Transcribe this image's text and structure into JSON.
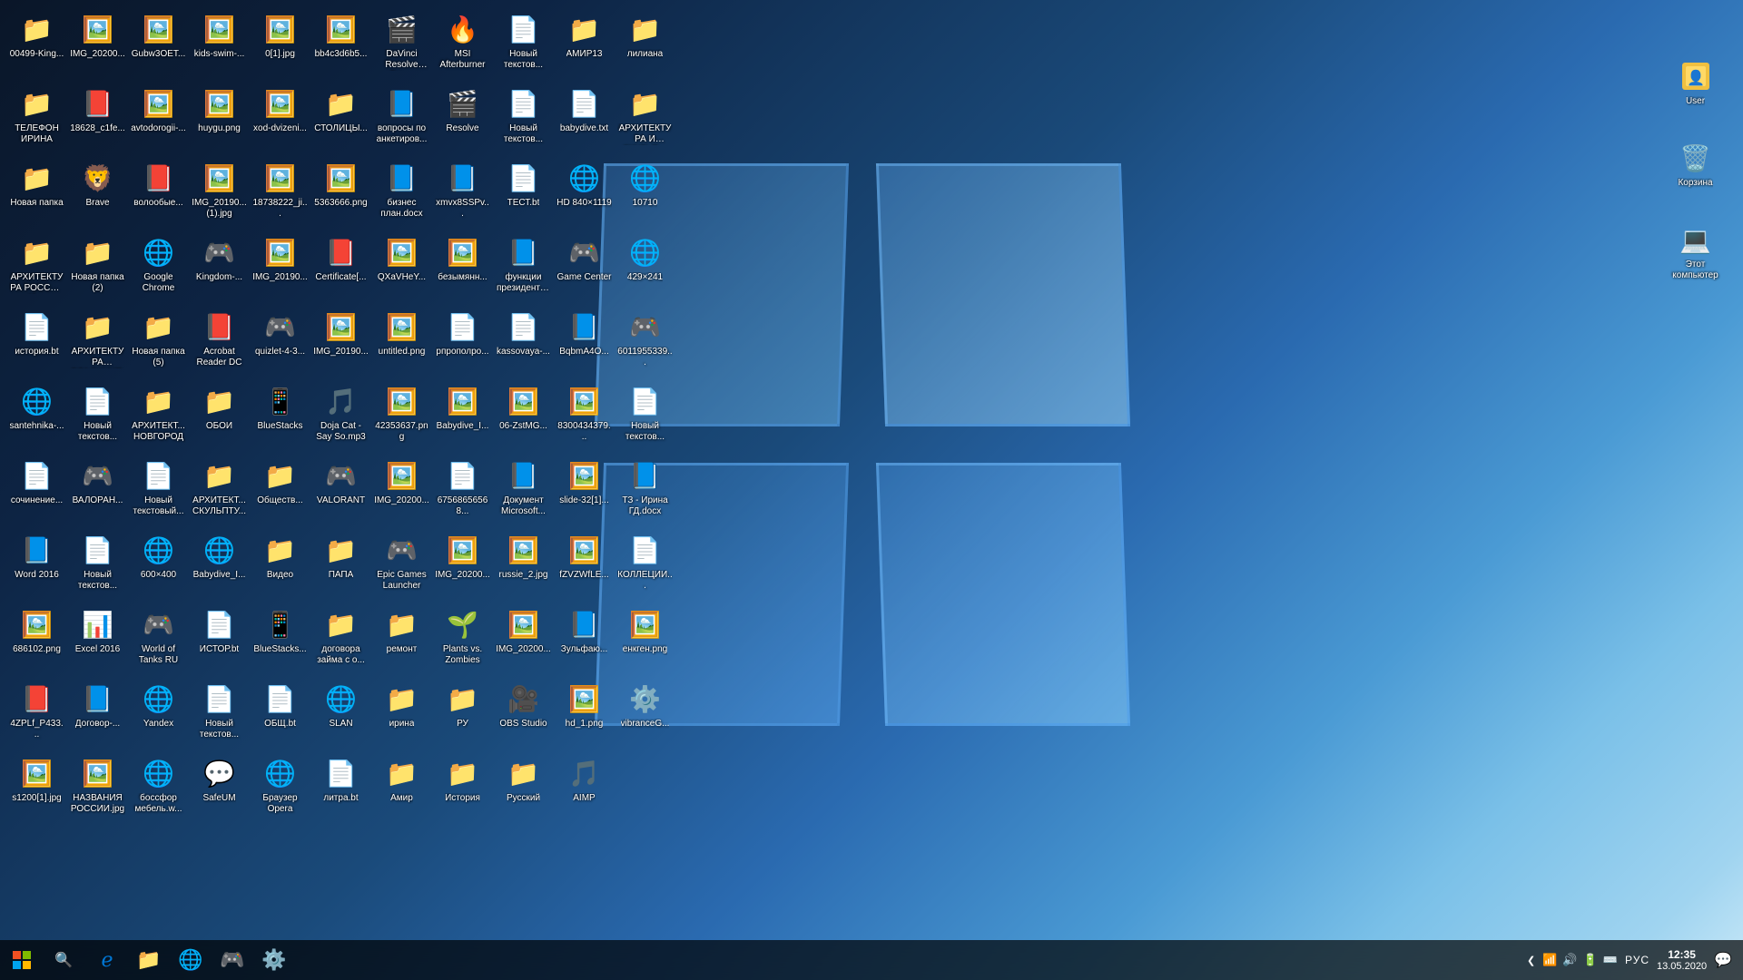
{
  "desktop": {
    "icons_row1": [
      {
        "id": "i1",
        "label": "00499-King...",
        "type": "folder",
        "emoji": "📁"
      },
      {
        "id": "i2",
        "label": "IMG_20200...",
        "type": "image",
        "emoji": "🖼️"
      },
      {
        "id": "i3",
        "label": "Gubw3OET...",
        "type": "image",
        "emoji": "🖼️"
      },
      {
        "id": "i4",
        "label": "kids-swim-...",
        "type": "image",
        "emoji": "🖼️"
      },
      {
        "id": "i5",
        "label": "0[1].jpg",
        "type": "image",
        "emoji": "🖼️"
      },
      {
        "id": "i6",
        "label": "bb4c3d6b5...",
        "type": "image",
        "emoji": "🖼️"
      },
      {
        "id": "i7",
        "label": "DaVinci Resolve Pro...",
        "type": "app",
        "emoji": "🎬"
      },
      {
        "id": "i8",
        "label": "MSI Afterburner",
        "type": "app",
        "emoji": "🔥"
      },
      {
        "id": "i9",
        "label": "Новый текстов...",
        "type": "txt",
        "emoji": "📄"
      },
      {
        "id": "i10",
        "label": "АМИР13",
        "type": "folder",
        "emoji": "📁"
      },
      {
        "id": "i11",
        "label": "лилиана",
        "type": "folder",
        "emoji": "📁"
      },
      {
        "id": "i12",
        "label": "ТЕЛЕФОН ИРИНА",
        "type": "folder",
        "emoji": "📁"
      }
    ],
    "icons_row2": [
      {
        "id": "j1",
        "label": "18628_c1fe...",
        "type": "pdf",
        "emoji": "📕"
      },
      {
        "id": "j2",
        "label": "avtodorogii-...",
        "type": "image",
        "emoji": "🖼️"
      },
      {
        "id": "j3",
        "label": "huygu.png",
        "type": "image",
        "emoji": "🖼️"
      },
      {
        "id": "j4",
        "label": "xod-dvizeni...",
        "type": "image",
        "emoji": "🖼️"
      },
      {
        "id": "j5",
        "label": "СТОЛИЦЫ...",
        "type": "folder",
        "emoji": "📁"
      },
      {
        "id": "j6",
        "label": "вопросы по анкетиров...",
        "type": "word",
        "emoji": "📘"
      },
      {
        "id": "j7",
        "label": "Resolve",
        "type": "app",
        "emoji": "🎬"
      },
      {
        "id": "j8",
        "label": "Новый текстов...",
        "type": "txt",
        "emoji": "📄"
      },
      {
        "id": "j9",
        "label": "babydive.txt",
        "type": "txt",
        "emoji": "📄"
      },
      {
        "id": "j10",
        "label": "АРХИТЕКТУРА И СКУЛЬП...",
        "type": "folder",
        "emoji": "📁"
      },
      {
        "id": "j11",
        "label": "Новая папка",
        "type": "folder",
        "emoji": "📁"
      },
      {
        "id": "j12",
        "label": "Brave",
        "type": "app",
        "emoji": "🦁"
      }
    ],
    "icons_row3": [
      {
        "id": "k1",
        "label": "волообые...",
        "type": "pdf",
        "emoji": "📕"
      },
      {
        "id": "k2",
        "label": "IMG_20190... (1).jpg",
        "type": "image",
        "emoji": "🖼️"
      },
      {
        "id": "k3",
        "label": "18738222_ji...",
        "type": "image",
        "emoji": "🖼️"
      },
      {
        "id": "k4",
        "label": "5363666.png",
        "type": "image",
        "emoji": "🖼️"
      },
      {
        "id": "k5",
        "label": "бизнес план.docx",
        "type": "word",
        "emoji": "📘"
      },
      {
        "id": "k6",
        "label": "xmvx8SSPv...",
        "type": "word",
        "emoji": "📘"
      },
      {
        "id": "k7",
        "label": "ТЕСТ.bt",
        "type": "txt",
        "emoji": "📄"
      },
      {
        "id": "k8",
        "label": "HD 840×1119",
        "type": "app",
        "emoji": "🌐"
      },
      {
        "id": "k9",
        "label": "10710",
        "type": "app",
        "emoji": "🌐"
      },
      {
        "id": "k10",
        "label": "АРХИТЕКТУРА РОССИЯ И...",
        "type": "folder",
        "emoji": "📁"
      },
      {
        "id": "k11",
        "label": "Новая папка (2)",
        "type": "folder",
        "emoji": "📁"
      },
      {
        "id": "k12",
        "label": "Google Chrome",
        "type": "app",
        "emoji": "🌐"
      }
    ],
    "icons_row4": [
      {
        "id": "l1",
        "label": "Kingdom-...",
        "type": "app",
        "emoji": "🎮"
      },
      {
        "id": "l2",
        "label": "IMG_20190...",
        "type": "image",
        "emoji": "🖼️"
      },
      {
        "id": "l3",
        "label": "Certificate[...",
        "type": "pdf",
        "emoji": "📕"
      },
      {
        "id": "l4",
        "label": "QXaVHeY...",
        "type": "image",
        "emoji": "🖼️"
      },
      {
        "id": "l5",
        "label": "безымянн...",
        "type": "image",
        "emoji": "🖼️"
      },
      {
        "id": "l6",
        "label": "функции президента...",
        "type": "word",
        "emoji": "📘"
      },
      {
        "id": "l7",
        "label": "Game Center",
        "type": "app",
        "emoji": "🎮"
      },
      {
        "id": "l8",
        "label": "429×241",
        "type": "app",
        "emoji": "🌐"
      },
      {
        "id": "l9",
        "label": "история.bt",
        "type": "txt",
        "emoji": "📄"
      },
      {
        "id": "l10",
        "label": "АРХИТЕКТУРА ВЛАДИМИР",
        "type": "folder",
        "emoji": "📁"
      },
      {
        "id": "l11",
        "label": "Новая папка (5)",
        "type": "folder",
        "emoji": "📁"
      },
      {
        "id": "l12",
        "label": "Acrobat Reader DC",
        "type": "app",
        "emoji": "📕"
      }
    ],
    "icons_row5": [
      {
        "id": "m1",
        "label": "quizlet-4-3...",
        "type": "app",
        "emoji": "🎮"
      },
      {
        "id": "m2",
        "label": "IMG_20190...",
        "type": "image",
        "emoji": "🖼️"
      },
      {
        "id": "m3",
        "label": "untitled.png",
        "type": "image",
        "emoji": "🖼️"
      },
      {
        "id": "m4",
        "label": "рпрополро...",
        "type": "txt",
        "emoji": "📄"
      },
      {
        "id": "m5",
        "label": "kassovaya-...",
        "type": "txt",
        "emoji": "📄"
      },
      {
        "id": "m6",
        "label": "BqbmA4O...",
        "type": "word",
        "emoji": "📘"
      },
      {
        "id": "m7",
        "label": "6011955339...",
        "type": "app",
        "emoji": "🎮"
      },
      {
        "id": "m8",
        "label": "santehnika-...",
        "type": "app",
        "emoji": "🌐"
      },
      {
        "id": "m9",
        "label": "Новый текстов...",
        "type": "txt",
        "emoji": "📄"
      },
      {
        "id": "m10",
        "label": "АРХИТЕКТ... НОВГОРОД",
        "type": "folder",
        "emoji": "📁"
      },
      {
        "id": "m11",
        "label": "ОБОИ",
        "type": "folder",
        "emoji": "📁"
      },
      {
        "id": "m12",
        "label": "BlueStacks",
        "type": "app",
        "emoji": "📱"
      }
    ],
    "icons_row6": [
      {
        "id": "n1",
        "label": "Doja Cat - Say So.mp3",
        "type": "music",
        "emoji": "🎵"
      },
      {
        "id": "n2",
        "label": "42353637.png",
        "type": "image",
        "emoji": "🖼️"
      },
      {
        "id": "n3",
        "label": "Babydive_I...",
        "type": "image",
        "emoji": "🖼️"
      },
      {
        "id": "n4",
        "label": "06-ZstMG...",
        "type": "image",
        "emoji": "🖼️"
      },
      {
        "id": "n5",
        "label": "8300434379...",
        "type": "image",
        "emoji": "🖼️"
      },
      {
        "id": "n6",
        "label": "Новый текстов...",
        "type": "txt",
        "emoji": "📄"
      },
      {
        "id": "n7",
        "label": "сочинение...",
        "type": "txt",
        "emoji": "📄"
      },
      {
        "id": "n8",
        "label": "ВАЛОРАН...",
        "type": "app",
        "emoji": "🎮"
      },
      {
        "id": "n9",
        "label": "Новый текстовый...",
        "type": "txt",
        "emoji": "📄"
      },
      {
        "id": "n10",
        "label": "АРХИТЕКТ... СКУЛЬПТУ...",
        "type": "folder",
        "emoji": "📁"
      },
      {
        "id": "n11",
        "label": "Обществ...",
        "type": "folder",
        "emoji": "📁"
      },
      {
        "id": "n12",
        "label": "VALORANT",
        "type": "app",
        "emoji": "🎮"
      }
    ],
    "icons_row7": [
      {
        "id": "o1",
        "label": "IMG_20200...",
        "type": "image",
        "emoji": "🖼️"
      },
      {
        "id": "o2",
        "label": "67568656568...",
        "type": "txt",
        "emoji": "📄"
      },
      {
        "id": "o3",
        "label": "Документ Microsoft...",
        "type": "word",
        "emoji": "📘"
      },
      {
        "id": "o4",
        "label": "slide-32[1]...",
        "type": "image",
        "emoji": "🖼️"
      },
      {
        "id": "o5",
        "label": "ТЗ - Ирина ГД.docx",
        "type": "word",
        "emoji": "📘"
      },
      {
        "id": "o6",
        "label": "Word 2016",
        "type": "app",
        "emoji": "📘"
      },
      {
        "id": "o7",
        "label": "Новый текстов...",
        "type": "txt",
        "emoji": "📄"
      },
      {
        "id": "o8",
        "label": "600×400",
        "type": "app",
        "emoji": "🌐"
      },
      {
        "id": "o9",
        "label": "Babydive_I...",
        "type": "app",
        "emoji": "🌐"
      },
      {
        "id": "o10",
        "label": "Видео",
        "type": "folder",
        "emoji": "📁"
      },
      {
        "id": "o11",
        "label": "ПАПА",
        "type": "folder",
        "emoji": "📁"
      },
      {
        "id": "o12",
        "label": "Epic Games Launcher",
        "type": "app",
        "emoji": "🎮"
      }
    ],
    "icons_row8": [
      {
        "id": "p1",
        "label": "IMG_20200...",
        "type": "image",
        "emoji": "🖼️"
      },
      {
        "id": "p2",
        "label": "russie_2.jpg",
        "type": "image",
        "emoji": "🖼️"
      },
      {
        "id": "p3",
        "label": "fZVZWfLE...",
        "type": "image",
        "emoji": "🖼️"
      },
      {
        "id": "p4",
        "label": "КОЛЛЕЦИИ...",
        "type": "txt",
        "emoji": "📄"
      },
      {
        "id": "p5",
        "label": "686102.png",
        "type": "image",
        "emoji": "🖼️"
      },
      {
        "id": "p6",
        "label": "Excel 2016",
        "type": "app",
        "emoji": "📊"
      },
      {
        "id": "p7",
        "label": "World of Tanks RU",
        "type": "app",
        "emoji": "🎮"
      },
      {
        "id": "p8",
        "label": "ИСТОР.bt",
        "type": "txt",
        "emoji": "📄"
      },
      {
        "id": "p9",
        "label": "BlueStacks...",
        "type": "app",
        "emoji": "📱"
      },
      {
        "id": "p10",
        "label": "договора займа с о...",
        "type": "folder",
        "emoji": "📁"
      },
      {
        "id": "p11",
        "label": "ремонт",
        "type": "folder",
        "emoji": "📁"
      },
      {
        "id": "p12",
        "label": "Plants vs. Zombies",
        "type": "app",
        "emoji": "🌱"
      }
    ],
    "icons_row9": [
      {
        "id": "q1",
        "label": "IMG_20200...",
        "type": "image",
        "emoji": "🖼️"
      },
      {
        "id": "q2",
        "label": "Зульфаю...",
        "type": "word",
        "emoji": "📘"
      },
      {
        "id": "q3",
        "label": "енкген.png",
        "type": "image",
        "emoji": "🖼️"
      },
      {
        "id": "q4",
        "label": "4ZPLf_P433...",
        "type": "pdf",
        "emoji": "📕"
      },
      {
        "id": "q5",
        "label": "Договор-...",
        "type": "word",
        "emoji": "📘"
      },
      {
        "id": "q6",
        "label": "Yandex",
        "type": "app",
        "emoji": "🌐"
      },
      {
        "id": "q7",
        "label": "Новый текстов...",
        "type": "txt",
        "emoji": "📄"
      },
      {
        "id": "q8",
        "label": "ОБЩ.bt",
        "type": "txt",
        "emoji": "📄"
      },
      {
        "id": "q9",
        "label": "SLAN",
        "type": "app",
        "emoji": "🌐"
      },
      {
        "id": "q10",
        "label": "ирина",
        "type": "folder",
        "emoji": "📁"
      },
      {
        "id": "q11",
        "label": "РУ",
        "type": "folder",
        "emoji": "📁"
      },
      {
        "id": "q12",
        "label": "OBS Studio",
        "type": "app",
        "emoji": "🎥"
      }
    ],
    "icons_row10": [
      {
        "id": "r1",
        "label": "hd_1.png",
        "type": "image",
        "emoji": "🖼️"
      },
      {
        "id": "r2",
        "label": "vibranceG...",
        "type": "app",
        "emoji": "⚙️"
      },
      {
        "id": "r3",
        "label": "s1200[1].jpg",
        "type": "image",
        "emoji": "🖼️"
      },
      {
        "id": "r4",
        "label": "НАЗВАНИЯ РОССИИ.jpg",
        "type": "image",
        "emoji": "🖼️"
      },
      {
        "id": "r5",
        "label": "боссфор мебель.w...",
        "type": "app",
        "emoji": "🌐"
      },
      {
        "id": "r6",
        "label": "SafeUM",
        "type": "app",
        "emoji": "💬"
      },
      {
        "id": "r7",
        "label": "Браузер Opera",
        "type": "app",
        "emoji": "🌐"
      },
      {
        "id": "r8",
        "label": "литра.bt",
        "type": "txt",
        "emoji": "📄"
      },
      {
        "id": "r9",
        "label": "Амир",
        "type": "folder",
        "emoji": "📁"
      },
      {
        "id": "r10",
        "label": "История",
        "type": "folder",
        "emoji": "📁"
      },
      {
        "id": "r11",
        "label": "Русский",
        "type": "folder",
        "emoji": "📁"
      },
      {
        "id": "r12",
        "label": "AIMP",
        "type": "app",
        "emoji": "🎵"
      }
    ]
  },
  "desktop_right_icons": [
    {
      "id": "dr1",
      "label": "User",
      "type": "folder",
      "emoji": "👤"
    },
    {
      "id": "dr2",
      "label": "Корзина",
      "type": "trash",
      "emoji": "🗑️"
    },
    {
      "id": "dr3",
      "label": "Этот компьютер",
      "type": "computer",
      "emoji": "💻"
    }
  ],
  "taskbar": {
    "start_icon": "⊞",
    "search_icon": "🔍",
    "apps": [
      {
        "id": "ta1",
        "label": "Edge",
        "emoji": "🌐",
        "color": "#0078d7"
      },
      {
        "id": "ta2",
        "label": "Explorer",
        "emoji": "📁",
        "color": "#f0c040"
      },
      {
        "id": "ta3",
        "label": "Chrome",
        "emoji": "🌐",
        "color": "#4285f4"
      },
      {
        "id": "ta4",
        "label": "Steam",
        "emoji": "🎮",
        "color": "#1b2838"
      }
    ],
    "tray": {
      "chevron": "❯",
      "network": "📶",
      "speaker": "🔊",
      "time": "12:35",
      "date": "13.05.2020",
      "language": "РУС",
      "notification": "🔔"
    }
  }
}
